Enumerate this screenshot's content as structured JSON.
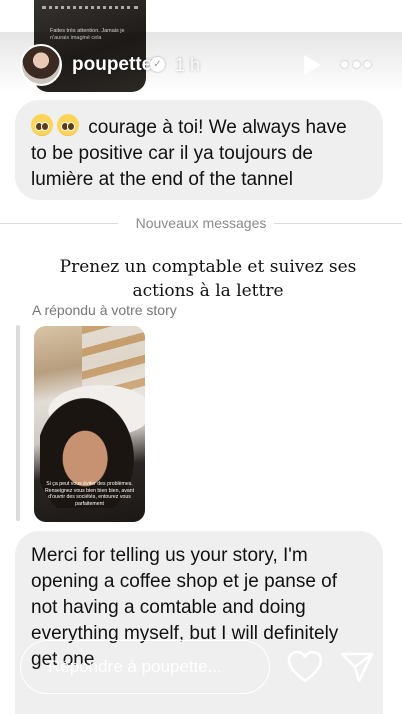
{
  "story": {
    "username": "poupette",
    "time_ago": "1 h",
    "top_thumbnail_caption": "Faites très attention. Jamais je n'aurais imaginé cela"
  },
  "messages": {
    "first": "courage à toi! We always have to be positive car il ya toujours de lumière at the end of the tannel",
    "divider": "Nouveaux messages",
    "story_heading": "Prenez un comptable et suivez ses actions à la lettre",
    "reply_label": "A répondu à votre story",
    "story_caption": "Si ça peut vous éviter des problèmes. Renseignez vous bien bien bien, avant d'ouvrir des sociétés, entourez vous parfaitement",
    "second": "Merci for telling us your story, I'm opening a coffee shop et je panse of not having a comtable and doing everything myself, but I will definitely get one"
  },
  "composer": {
    "placeholder": "Répondre à poupette..."
  },
  "icons": {
    "verified": "verified-badge-icon",
    "play": "play-icon",
    "more": "more-options-icon",
    "heart": "heart-icon",
    "send": "send-icon"
  },
  "colors": {
    "bubble": "#efefef",
    "divider_text": "#8a8a8a"
  }
}
